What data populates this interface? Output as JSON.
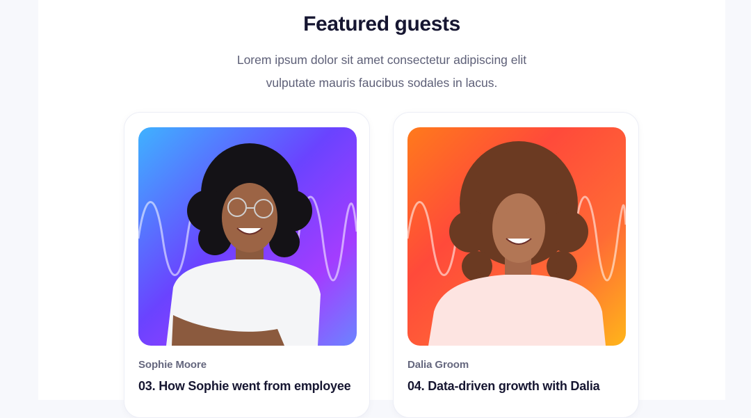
{
  "featured": {
    "title": "Featured guests",
    "subtitle_lines": [
      "Lorem ipsum dolor sit amet consectetur adipiscing elit",
      "vulputate mauris faucibus sodales in lacus."
    ]
  },
  "guests": [
    {
      "name": "Sophie Moore",
      "episode": "03. How Sophie went from employee",
      "gradient": [
        "#3fb2ff",
        "#6a43ff",
        "#a33dff",
        "#6b84ff"
      ],
      "shirt_color": "#f4f5f7",
      "icon": "guest-photo-icon"
    },
    {
      "name": "Dalia Groom",
      "episode": "04. Data-driven growth with Dalia",
      "gradient": [
        "#ff7a1c",
        "#ff4a3a",
        "#ff6b35",
        "#ffb51a"
      ],
      "shirt_color": "#fde4e1",
      "icon": "guest-photo-icon"
    }
  ]
}
